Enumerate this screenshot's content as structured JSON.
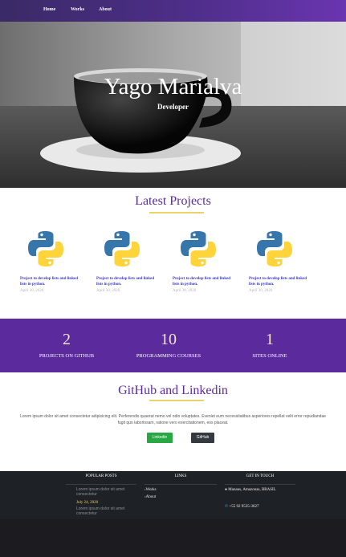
{
  "nav": {
    "items": [
      "Home",
      "Works",
      "About"
    ]
  },
  "hero": {
    "title": "Yago Marialva",
    "subtitle": "Developer"
  },
  "projects": {
    "title": "Latest Projects",
    "items": [
      {
        "title": "Project to develop lists and linked lists in python.",
        "date": "April 30, 2020",
        "icon": "python-logo-icon"
      },
      {
        "title": "Project to develop lists and linked lists in python.",
        "date": "April 30, 2020",
        "icon": "python-logo-icon"
      },
      {
        "title": "Project to develop lists and linked lists in python.",
        "date": "April 30, 2020",
        "icon": "python-logo-icon"
      },
      {
        "title": "Project to develop lists and linked lists in python.",
        "date": "April 30, 2020",
        "icon": "python-logo-icon"
      }
    ]
  },
  "stats": [
    {
      "value": "2",
      "label": "PROJECTS ON GITHUB"
    },
    {
      "value": "10",
      "label": "PROGRAMMING COURSES"
    },
    {
      "value": "1",
      "label": "SITES ONLINE"
    }
  ],
  "social": {
    "title": "GitHub and Linkedin",
    "text": "Lorem ipsum dolor sit amet consectetur adipisicing elit. Perferendis quaerat nemo vel odio voluptates. Eveniet eum necessitatibus asperiores repellat velit error repudiandae fugit quo laboriosam, ratione vero exercitationem, eos placeat.",
    "linkedin_label": "Linkedin",
    "github_label": "GitHub"
  },
  "footer": {
    "popular_posts": {
      "title": "POPULAR POSTS",
      "post1": "Lorem ipsum dolor sit amet consectetur",
      "date": "July 24, 2020",
      "post2": "Lorem ipsum dolor sit amet consectetur"
    },
    "links": {
      "title": "LINKS",
      "items": [
        "Works",
        "About"
      ]
    },
    "contact": {
      "title": "GET IN TOUCH",
      "address": "Manaus, Amazonas, BRASIL",
      "phone": "+55 92 9535-3627"
    }
  },
  "colors": {
    "nav": "#4e2e8a",
    "accent": "#5b2b9e",
    "divider": "#e9d36a",
    "linkedin": "#28a745",
    "github": "#343a40",
    "footer": "#1e2226"
  }
}
